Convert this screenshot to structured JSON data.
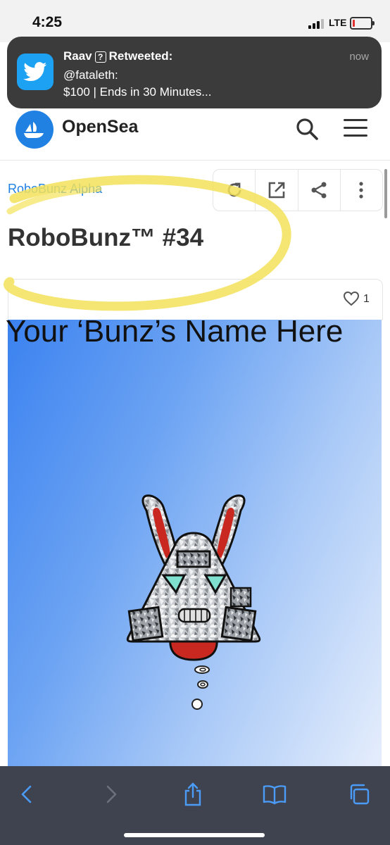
{
  "status_bar": {
    "time": "4:25",
    "network": "LTE",
    "signal_bars_active": 3,
    "signal_bars_total": 4,
    "battery_level": 0.12,
    "battery_color": "#e03030"
  },
  "notification": {
    "app_icon": "twitter-bird-icon",
    "sender": "Raav",
    "sender_badge": "?",
    "action": "Retweeted:",
    "handle": "@fataleth:",
    "message": "$100 | Ends in 30 Minutes...",
    "time": "now",
    "background": "#3b3b3b"
  },
  "navbar": {
    "logo_icon": "opensea-sailboat-icon",
    "brand": "OpenSea",
    "brand_color": "#2081e2",
    "search_icon": "search-icon",
    "menu_icon": "hamburger-menu-icon"
  },
  "item": {
    "collection": "RoboBunz Alpha",
    "title": "RoboBunz™ #34",
    "actions": [
      "refresh-icon",
      "external-link-icon",
      "share-icon",
      "more-vertical-icon"
    ],
    "likes": "1",
    "image_caption": "Your ‘Bunz’s Name Here"
  },
  "annotation": {
    "type": "hand-drawn highlight ellipse",
    "color": "#f3e25a"
  },
  "browser_toolbar": {
    "buttons": [
      "back-icon",
      "forward-icon",
      "share-icon",
      "bookmarks-icon",
      "tabs-icon"
    ],
    "background": "#3f4350",
    "accent": "#4a9cf8"
  }
}
